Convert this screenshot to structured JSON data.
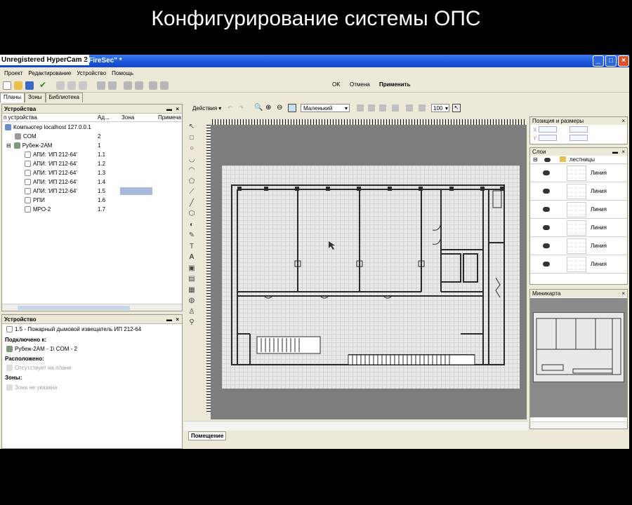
{
  "caption": "Конфигурирование системы ОПС",
  "window": {
    "hypercam_label": "Unregistered HyperCam 2",
    "title": "- FireSec\" *"
  },
  "menu": [
    "Проект",
    "Редактирование",
    "Устройство",
    "Помощь"
  ],
  "toolbar": {
    "ok": "OK",
    "cancel": "Отмена",
    "apply": "Применить"
  },
  "tabs": [
    "Планы",
    "Зоны",
    "Библиотека"
  ],
  "devices_panel": {
    "title": "Устройства",
    "columns": [
      "п устройства",
      "Ад...",
      "Зона",
      "Примеча"
    ],
    "rows": [
      {
        "name": "Компьютер localhost 127.0.0.1",
        "addr": ""
      },
      {
        "name": "COM",
        "addr": "2"
      },
      {
        "name": "Рубеж-2АМ",
        "addr": "1"
      },
      {
        "name": "АПИ: 'ИП 212-64'",
        "addr": "1.1"
      },
      {
        "name": "АПИ: 'ИП 212-64'",
        "addr": "1.2"
      },
      {
        "name": "АПИ: 'ИП 212-64'",
        "addr": "1.3"
      },
      {
        "name": "АПИ: 'ИП 212-64'",
        "addr": "1.4"
      },
      {
        "name": "АПИ: 'ИП 212-64'",
        "addr": "1.5"
      },
      {
        "name": "РПИ",
        "addr": "1.6"
      },
      {
        "name": "МРО-2",
        "addr": "1.7"
      }
    ]
  },
  "device_panel": {
    "title": "Устройство",
    "device": "1.5 - Пожарный дымовой извещатель ИП 212-64",
    "connected_label": "Подключено к:",
    "connected_value": "Рубеж-2АМ - 1\\ COM - 2",
    "location_label": "Расположено:",
    "location_value": "Отсутствует на плане",
    "zones_label": "Зоны:",
    "zones_value": "Зона не указана"
  },
  "canvas": {
    "actions_label": "Действия",
    "size_select": "Маленький",
    "zoom": "100",
    "room_tab": "Помещение"
  },
  "right_panel": {
    "position_title": "Позиция и размеры",
    "x_label": "X",
    "y_label": "Y",
    "layers_title": "Слои",
    "layer_group": "лестницы",
    "layer_items": [
      "Линия",
      "Линия",
      "Линия",
      "Линия",
      "Линия",
      "Линия"
    ],
    "minimap_title": "Миникарта"
  }
}
